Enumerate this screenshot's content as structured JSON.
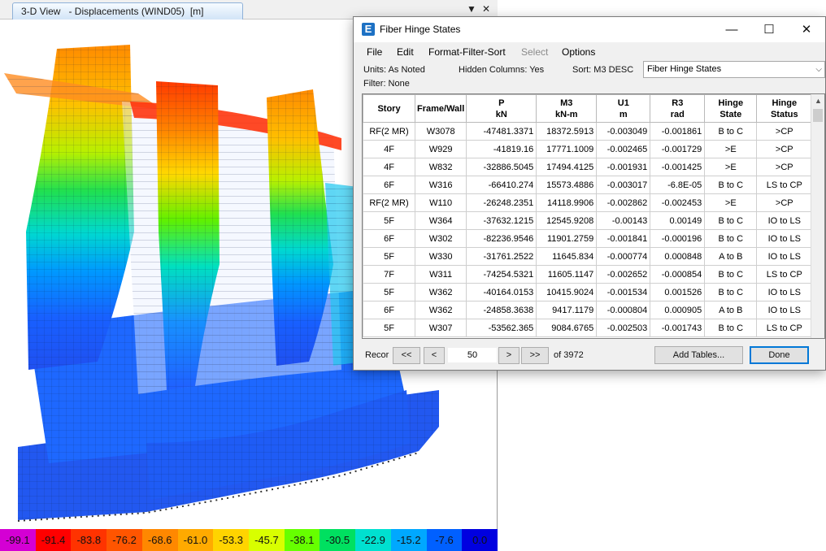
{
  "view": {
    "tab_title": "3-D View   - Displacements (WIND05)  [m]",
    "menu_arrow": "▼",
    "close_glyph": "✕",
    "legend": {
      "labels": [
        "-99.1",
        "-91.4",
        "-83.8",
        "-76.2",
        "-68.6",
        "-61.0",
        "-53.3",
        "-45.7",
        "-38.1",
        "-30.5",
        "-22.9",
        "-15.2",
        "-7.6",
        "0.0"
      ],
      "colors": [
        "#d400d4",
        "#ff0000",
        "#ff3300",
        "#ff5500",
        "#ff8800",
        "#ffaa00",
        "#ffd400",
        "#d8ff00",
        "#66ff00",
        "#00e060",
        "#00e0d0",
        "#00a8ff",
        "#0060ff",
        "#0000e0"
      ]
    }
  },
  "dialog": {
    "title": "Fiber Hinge States",
    "app_icon": "E",
    "controls": {
      "minimize": "—",
      "maximize": "☐",
      "close": "✕"
    },
    "menu": [
      {
        "label": "File",
        "enabled": true
      },
      {
        "label": "Edit",
        "enabled": true
      },
      {
        "label": "Format-Filter-Sort",
        "enabled": true
      },
      {
        "label": "Select",
        "enabled": false
      },
      {
        "label": "Options",
        "enabled": true
      }
    ],
    "info": {
      "units": "Units:  As Noted",
      "hidden_columns": "Hidden Columns:  Yes",
      "sort": "Sort:  M3 DESC",
      "filter": "Filter:  None"
    },
    "table_selector": {
      "value": "Fiber Hinge States",
      "arrow": "⌵"
    },
    "columns": [
      {
        "label": "Story",
        "unit": ""
      },
      {
        "label": "Frame/Wall",
        "unit": ""
      },
      {
        "label": "P",
        "unit": "kN"
      },
      {
        "label": "M3",
        "unit": "kN-m"
      },
      {
        "label": "U1",
        "unit": "m"
      },
      {
        "label": "R3",
        "unit": "rad"
      },
      {
        "label": "Hinge",
        "unit": "State"
      },
      {
        "label": "Hinge",
        "unit": "Status"
      }
    ],
    "rows": [
      [
        "RF(2 MR)",
        "W3078",
        "-47481.3371",
        "18372.5913",
        "-0.003049",
        "-0.001861",
        "B to C",
        ">CP"
      ],
      [
        "4F",
        "W929",
        "-41819.16",
        "17771.1009",
        "-0.002465",
        "-0.001729",
        ">E",
        ">CP"
      ],
      [
        "4F",
        "W832",
        "-32886.5045",
        "17494.4125",
        "-0.001931",
        "-0.001425",
        ">E",
        ">CP"
      ],
      [
        "6F",
        "W316",
        "-66410.274",
        "15573.4886",
        "-0.003017",
        "-6.8E-05",
        "B to C",
        "LS to CP"
      ],
      [
        "RF(2 MR)",
        "W110",
        "-26248.2351",
        "14118.9906",
        "-0.002862",
        "-0.002453",
        ">E",
        ">CP"
      ],
      [
        "5F",
        "W364",
        "-37632.1215",
        "12545.9208",
        "-0.00143",
        "0.00149",
        "B to C",
        "IO to LS"
      ],
      [
        "6F",
        "W302",
        "-82236.9546",
        "11901.2759",
        "-0.001841",
        "-0.000196",
        "B to C",
        "IO to LS"
      ],
      [
        "5F",
        "W330",
        "-31761.2522",
        "11645.834",
        "-0.000774",
        "0.000848",
        "A to B",
        "IO to LS"
      ],
      [
        "7F",
        "W311",
        "-74254.5321",
        "11605.1147",
        "-0.002652",
        "-0.000854",
        "B to C",
        "LS to CP"
      ],
      [
        "5F",
        "W362",
        "-40164.0153",
        "10415.9024",
        "-0.001534",
        "0.001526",
        "B to C",
        "IO to LS"
      ],
      [
        "6F",
        "W362",
        "-24858.3638",
        "9417.1179",
        "-0.000804",
        "0.000905",
        "A to B",
        "IO to LS"
      ],
      [
        "5F",
        "W307",
        "-53562.365",
        "9084.6765",
        "-0.002503",
        "-0.001743",
        "B to C",
        "LS to CP"
      ]
    ],
    "navigation": {
      "label": "Recor",
      "first": "<<",
      "prev": "<",
      "record": "50",
      "next": ">",
      "last": ">>",
      "total": "of 3972"
    },
    "buttons": {
      "add_tables": "Add Tables...",
      "done": "Done"
    }
  }
}
